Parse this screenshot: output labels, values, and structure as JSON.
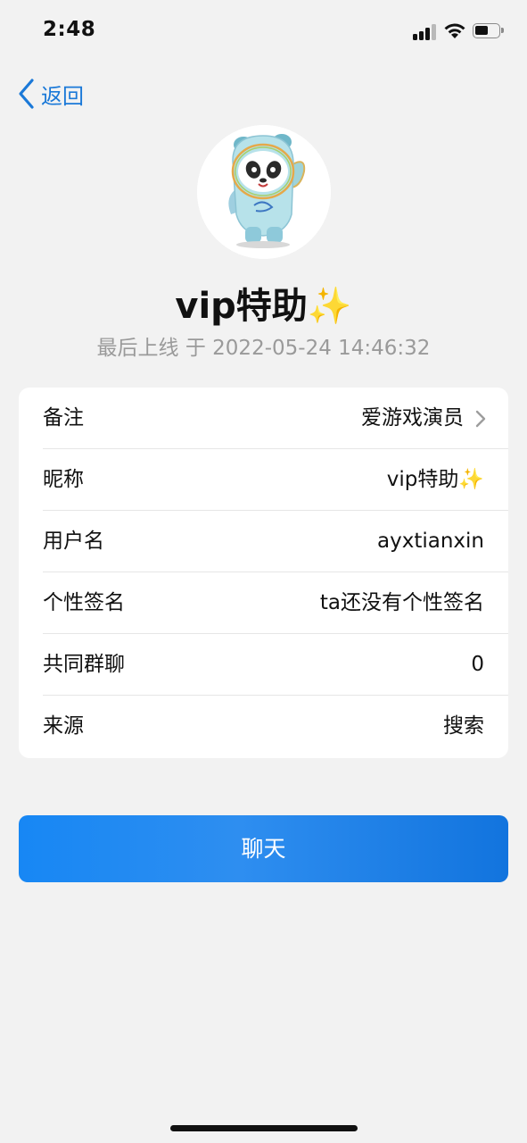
{
  "status_bar": {
    "time": "2:48"
  },
  "nav": {
    "back_label": "返回"
  },
  "profile": {
    "nickname": "vip特助✨",
    "last_seen": "最后上线 于 2022-05-24 14:46:32"
  },
  "info_rows": [
    {
      "label": "备注",
      "value": "爱游戏演员"
    },
    {
      "label": "昵称",
      "value": "vip特助✨"
    },
    {
      "label": "用户名",
      "value": "ayxtianxin"
    },
    {
      "label": "个性签名",
      "value": "ta还没有个性签名"
    },
    {
      "label": "共同群聊",
      "value": "0"
    },
    {
      "label": "来源",
      "value": "搜索"
    }
  ],
  "actions": {
    "chat_label": "聊天"
  },
  "colors": {
    "accent": "#1b79d8",
    "button": "#1787f4",
    "background": "#f2f2f2"
  }
}
